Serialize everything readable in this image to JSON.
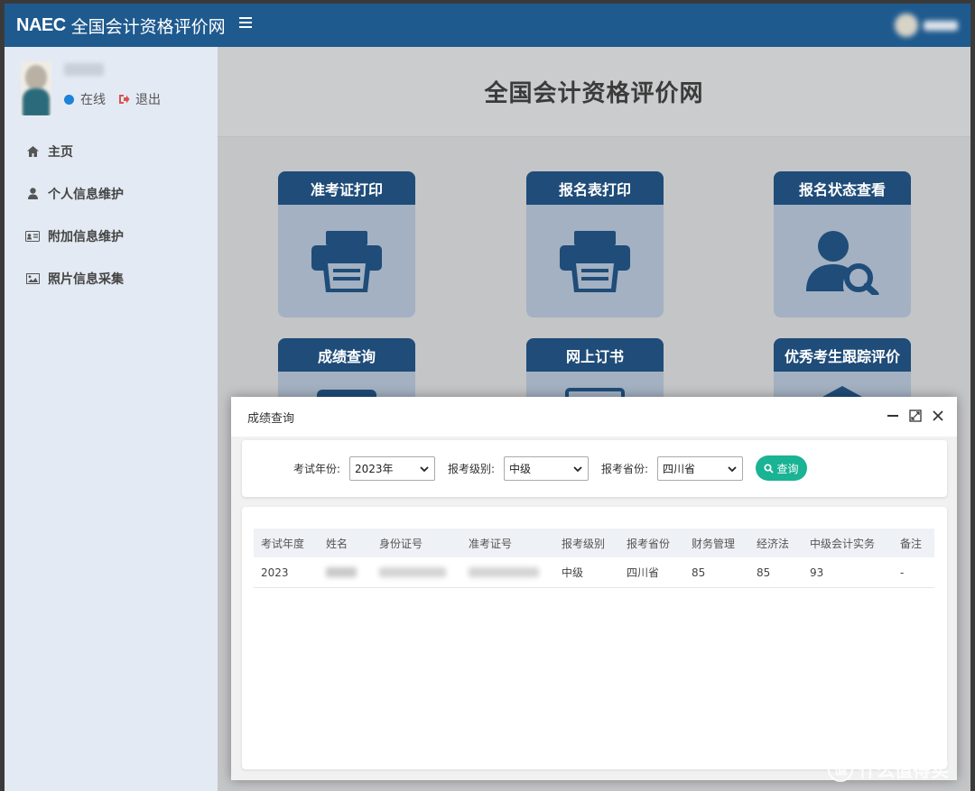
{
  "topbar": {
    "brand_short": "NAEC",
    "brand_name": "全国会计资格评价网"
  },
  "sidebar": {
    "status_online": "在线",
    "logout": "退出",
    "items": [
      {
        "label": "主页",
        "icon": "home-icon"
      },
      {
        "label": "个人信息维护",
        "icon": "user-icon"
      },
      {
        "label": "附加信息维护",
        "icon": "id-card-icon"
      },
      {
        "label": "照片信息采集",
        "icon": "image-icon"
      }
    ]
  },
  "main": {
    "title": "全国会计资格评价网",
    "tiles": [
      {
        "label": "准考证打印",
        "icon": "printer-icon"
      },
      {
        "label": "报名表打印",
        "icon": "printer-icon"
      },
      {
        "label": "报名状态查看",
        "icon": "user-search-icon"
      },
      {
        "label": "成绩查询",
        "icon": "score-icon"
      },
      {
        "label": "网上订书",
        "icon": "book-icon"
      },
      {
        "label": "优秀考生跟踪评价",
        "icon": "graduation-icon"
      }
    ]
  },
  "modal": {
    "title": "成绩查询",
    "filters": {
      "year_label": "考试年份:",
      "year_value": "2023年",
      "level_label": "报考级别:",
      "level_value": "中级",
      "province_label": "报考省份:",
      "province_value": "四川省",
      "search_button": "查询"
    },
    "table": {
      "columns": [
        "考试年度",
        "姓名",
        "身份证号",
        "准考证号",
        "报考级别",
        "报考省份",
        "财务管理",
        "经济法",
        "中级会计实务",
        "备注"
      ],
      "row": [
        "2023",
        "",
        "",
        "",
        "中级",
        "四川省",
        "85",
        "85",
        "93",
        "-"
      ]
    }
  },
  "watermark": {
    "text": "什么值得买",
    "logo": "值"
  },
  "colors": {
    "topbar": "#1f5a8e",
    "tile_header": "#1f4c78",
    "tile_body": "#a3b1c2",
    "query_button": "#1ab394",
    "online_dot": "#1d82d9",
    "logout_icon": "#d9534f"
  }
}
